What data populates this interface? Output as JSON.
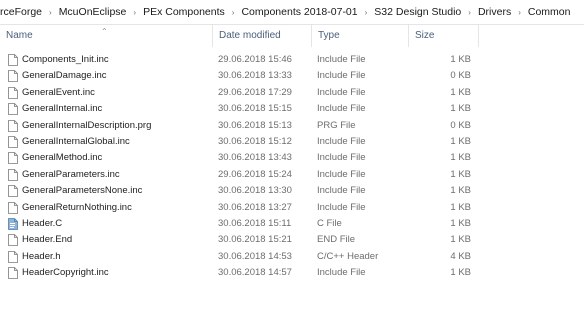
{
  "breadcrumb": [
    "rceForge",
    "McuOnEclipse",
    "PEx Components",
    "Components 2018-07-01",
    "S32 Design Studio",
    "Drivers",
    "Common"
  ],
  "columns": {
    "name": "Name",
    "date": "Date modified",
    "type": "Type",
    "size": "Size"
  },
  "files": [
    {
      "name": "Components_Init.inc",
      "date": "29.06.2018 15:46",
      "type": "Include File",
      "size": "1 KB",
      "icon": "file-icon"
    },
    {
      "name": "GeneralDamage.inc",
      "date": "30.06.2018 13:33",
      "type": "Include File",
      "size": "0 KB",
      "icon": "file-icon"
    },
    {
      "name": "GeneralEvent.inc",
      "date": "29.06.2018 17:29",
      "type": "Include File",
      "size": "1 KB",
      "icon": "file-icon"
    },
    {
      "name": "GeneralInternal.inc",
      "date": "30.06.2018 15:15",
      "type": "Include File",
      "size": "1 KB",
      "icon": "file-icon"
    },
    {
      "name": "GeneralInternalDescription.prg",
      "date": "30.06.2018 15:13",
      "type": "PRG File",
      "size": "0 KB",
      "icon": "file-icon"
    },
    {
      "name": "GeneralInternalGlobal.inc",
      "date": "30.06.2018 15:12",
      "type": "Include File",
      "size": "1 KB",
      "icon": "file-icon"
    },
    {
      "name": "GeneralMethod.inc",
      "date": "30.06.2018 13:43",
      "type": "Include File",
      "size": "1 KB",
      "icon": "file-icon"
    },
    {
      "name": "GeneralParameters.inc",
      "date": "29.06.2018 15:24",
      "type": "Include File",
      "size": "1 KB",
      "icon": "file-icon"
    },
    {
      "name": "GeneralParametersNone.inc",
      "date": "30.06.2018 13:30",
      "type": "Include File",
      "size": "1 KB",
      "icon": "file-icon"
    },
    {
      "name": "GeneralReturnNothing.inc",
      "date": "30.06.2018 13:27",
      "type": "Include File",
      "size": "1 KB",
      "icon": "file-icon"
    },
    {
      "name": "Header.C",
      "date": "30.06.2018 15:11",
      "type": "C File",
      "size": "1 KB",
      "icon": "c-source-file-icon"
    },
    {
      "name": "Header.End",
      "date": "30.06.2018 15:21",
      "type": "END File",
      "size": "1 KB",
      "icon": "file-icon"
    },
    {
      "name": "Header.h",
      "date": "30.06.2018 14:53",
      "type": "C/C++ Header",
      "size": "4 KB",
      "icon": "file-icon"
    },
    {
      "name": "HeaderCopyright.inc",
      "date": "30.06.2018 14:57",
      "type": "Include File",
      "size": "1 KB",
      "icon": "file-icon"
    }
  ]
}
